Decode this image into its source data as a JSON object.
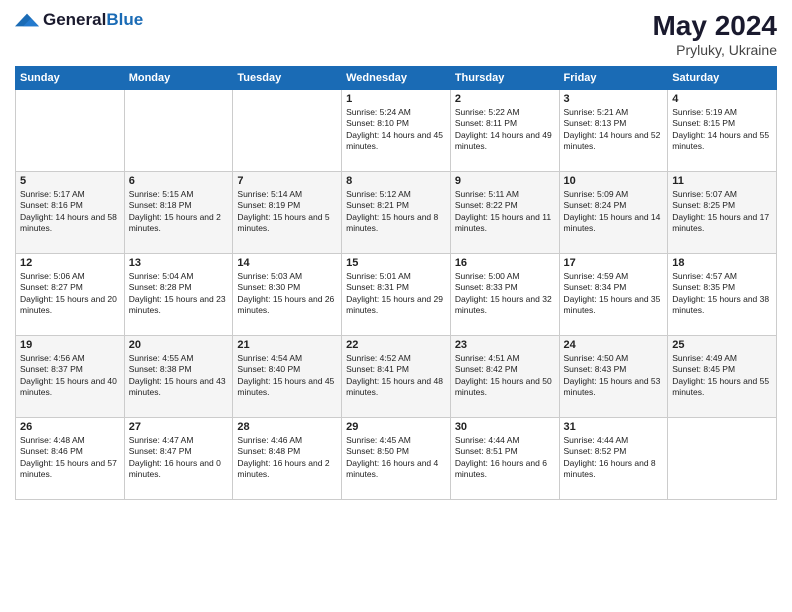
{
  "logo": {
    "text_general": "General",
    "text_blue": "Blue"
  },
  "header": {
    "month_year": "May 2024",
    "location": "Pryluky, Ukraine"
  },
  "weekdays": [
    "Sunday",
    "Monday",
    "Tuesday",
    "Wednesday",
    "Thursday",
    "Friday",
    "Saturday"
  ],
  "weeks": [
    [
      null,
      null,
      null,
      {
        "day": "1",
        "sunrise": "Sunrise: 5:24 AM",
        "sunset": "Sunset: 8:10 PM",
        "daylight": "Daylight: 14 hours and 45 minutes."
      },
      {
        "day": "2",
        "sunrise": "Sunrise: 5:22 AM",
        "sunset": "Sunset: 8:11 PM",
        "daylight": "Daylight: 14 hours and 49 minutes."
      },
      {
        "day": "3",
        "sunrise": "Sunrise: 5:21 AM",
        "sunset": "Sunset: 8:13 PM",
        "daylight": "Daylight: 14 hours and 52 minutes."
      },
      {
        "day": "4",
        "sunrise": "Sunrise: 5:19 AM",
        "sunset": "Sunset: 8:15 PM",
        "daylight": "Daylight: 14 hours and 55 minutes."
      }
    ],
    [
      {
        "day": "5",
        "sunrise": "Sunrise: 5:17 AM",
        "sunset": "Sunset: 8:16 PM",
        "daylight": "Daylight: 14 hours and 58 minutes."
      },
      {
        "day": "6",
        "sunrise": "Sunrise: 5:15 AM",
        "sunset": "Sunset: 8:18 PM",
        "daylight": "Daylight: 15 hours and 2 minutes."
      },
      {
        "day": "7",
        "sunrise": "Sunrise: 5:14 AM",
        "sunset": "Sunset: 8:19 PM",
        "daylight": "Daylight: 15 hours and 5 minutes."
      },
      {
        "day": "8",
        "sunrise": "Sunrise: 5:12 AM",
        "sunset": "Sunset: 8:21 PM",
        "daylight": "Daylight: 15 hours and 8 minutes."
      },
      {
        "day": "9",
        "sunrise": "Sunrise: 5:11 AM",
        "sunset": "Sunset: 8:22 PM",
        "daylight": "Daylight: 15 hours and 11 minutes."
      },
      {
        "day": "10",
        "sunrise": "Sunrise: 5:09 AM",
        "sunset": "Sunset: 8:24 PM",
        "daylight": "Daylight: 15 hours and 14 minutes."
      },
      {
        "day": "11",
        "sunrise": "Sunrise: 5:07 AM",
        "sunset": "Sunset: 8:25 PM",
        "daylight": "Daylight: 15 hours and 17 minutes."
      }
    ],
    [
      {
        "day": "12",
        "sunrise": "Sunrise: 5:06 AM",
        "sunset": "Sunset: 8:27 PM",
        "daylight": "Daylight: 15 hours and 20 minutes."
      },
      {
        "day": "13",
        "sunrise": "Sunrise: 5:04 AM",
        "sunset": "Sunset: 8:28 PM",
        "daylight": "Daylight: 15 hours and 23 minutes."
      },
      {
        "day": "14",
        "sunrise": "Sunrise: 5:03 AM",
        "sunset": "Sunset: 8:30 PM",
        "daylight": "Daylight: 15 hours and 26 minutes."
      },
      {
        "day": "15",
        "sunrise": "Sunrise: 5:01 AM",
        "sunset": "Sunset: 8:31 PM",
        "daylight": "Daylight: 15 hours and 29 minutes."
      },
      {
        "day": "16",
        "sunrise": "Sunrise: 5:00 AM",
        "sunset": "Sunset: 8:33 PM",
        "daylight": "Daylight: 15 hours and 32 minutes."
      },
      {
        "day": "17",
        "sunrise": "Sunrise: 4:59 AM",
        "sunset": "Sunset: 8:34 PM",
        "daylight": "Daylight: 15 hours and 35 minutes."
      },
      {
        "day": "18",
        "sunrise": "Sunrise: 4:57 AM",
        "sunset": "Sunset: 8:35 PM",
        "daylight": "Daylight: 15 hours and 38 minutes."
      }
    ],
    [
      {
        "day": "19",
        "sunrise": "Sunrise: 4:56 AM",
        "sunset": "Sunset: 8:37 PM",
        "daylight": "Daylight: 15 hours and 40 minutes."
      },
      {
        "day": "20",
        "sunrise": "Sunrise: 4:55 AM",
        "sunset": "Sunset: 8:38 PM",
        "daylight": "Daylight: 15 hours and 43 minutes."
      },
      {
        "day": "21",
        "sunrise": "Sunrise: 4:54 AM",
        "sunset": "Sunset: 8:40 PM",
        "daylight": "Daylight: 15 hours and 45 minutes."
      },
      {
        "day": "22",
        "sunrise": "Sunrise: 4:52 AM",
        "sunset": "Sunset: 8:41 PM",
        "daylight": "Daylight: 15 hours and 48 minutes."
      },
      {
        "day": "23",
        "sunrise": "Sunrise: 4:51 AM",
        "sunset": "Sunset: 8:42 PM",
        "daylight": "Daylight: 15 hours and 50 minutes."
      },
      {
        "day": "24",
        "sunrise": "Sunrise: 4:50 AM",
        "sunset": "Sunset: 8:43 PM",
        "daylight": "Daylight: 15 hours and 53 minutes."
      },
      {
        "day": "25",
        "sunrise": "Sunrise: 4:49 AM",
        "sunset": "Sunset: 8:45 PM",
        "daylight": "Daylight: 15 hours and 55 minutes."
      }
    ],
    [
      {
        "day": "26",
        "sunrise": "Sunrise: 4:48 AM",
        "sunset": "Sunset: 8:46 PM",
        "daylight": "Daylight: 15 hours and 57 minutes."
      },
      {
        "day": "27",
        "sunrise": "Sunrise: 4:47 AM",
        "sunset": "Sunset: 8:47 PM",
        "daylight": "Daylight: 16 hours and 0 minutes."
      },
      {
        "day": "28",
        "sunrise": "Sunrise: 4:46 AM",
        "sunset": "Sunset: 8:48 PM",
        "daylight": "Daylight: 16 hours and 2 minutes."
      },
      {
        "day": "29",
        "sunrise": "Sunrise: 4:45 AM",
        "sunset": "Sunset: 8:50 PM",
        "daylight": "Daylight: 16 hours and 4 minutes."
      },
      {
        "day": "30",
        "sunrise": "Sunrise: 4:44 AM",
        "sunset": "Sunset: 8:51 PM",
        "daylight": "Daylight: 16 hours and 6 minutes."
      },
      {
        "day": "31",
        "sunrise": "Sunrise: 4:44 AM",
        "sunset": "Sunset: 8:52 PM",
        "daylight": "Daylight: 16 hours and 8 minutes."
      },
      null
    ]
  ]
}
